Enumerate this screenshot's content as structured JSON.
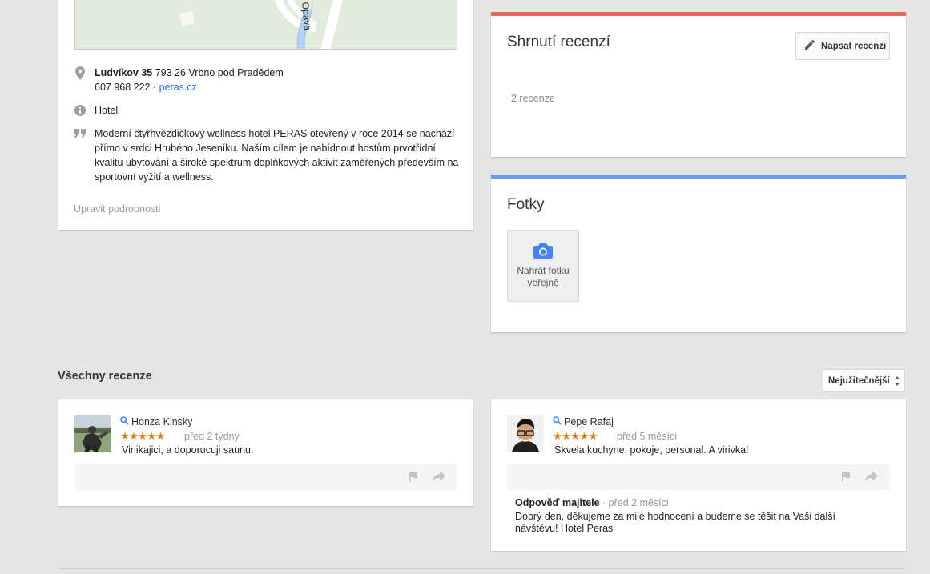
{
  "map": {
    "road_label": "Opava"
  },
  "place": {
    "address_bold": "Ludvíkov 35",
    "address_rest": " 793 26 Vrbno pod Pradědem",
    "phone": "607 968 222",
    "separator": " · ",
    "website": "peras.cz",
    "category": "Hotel",
    "description": "Moderní čtyřhvězdičkový wellness hotel PERAS otevřený v roce 2014 se nachází přímo v srdci Hrubého Jeseníku. Naším cílem je nabídnout hostům prvotřídní kvalitu ubytování a široké spektrum doplňkových aktivit zaměřených především na sportovní vyžití a wellness.",
    "edit_label": "Upravit podrobnosti"
  },
  "summary": {
    "title": "Shrnutí recenzí",
    "write_button": "Napsat recenzi",
    "count": "2 recenze",
    "accent": "#e06c5f"
  },
  "photos": {
    "title": "Fotky",
    "upload_label_1": "Nahrát fotku",
    "upload_label_2": "veřejně",
    "accent": "#6d9eeb"
  },
  "reviews": {
    "title": "Všechny recenze",
    "sort_selected": "Nejužitečnější",
    "items": [
      {
        "author": "Honza Kinsky",
        "stars": "★★★★★",
        "rating": 5,
        "time": "před 2 týdny",
        "text": "Vinikajici, a doporucuji saunu."
      },
      {
        "author": "Pepe Rafaj",
        "stars": "★★★★★",
        "rating": 5,
        "time": "před 5 měsíci",
        "text": "Skvela kuchyne, pokoje, personal. A virivka!",
        "owner_reply": {
          "label": "Odpověď majitele",
          "time": " · před 2 měsíci",
          "text": "Dobrý den, děkujeme za milé hodnocení a budeme se těšit na Vaši další návštěvu! Hotel Peras"
        }
      }
    ]
  },
  "colors": {
    "star": "#e8790c",
    "link": "#1a73e8",
    "camera": "#4285f4"
  }
}
